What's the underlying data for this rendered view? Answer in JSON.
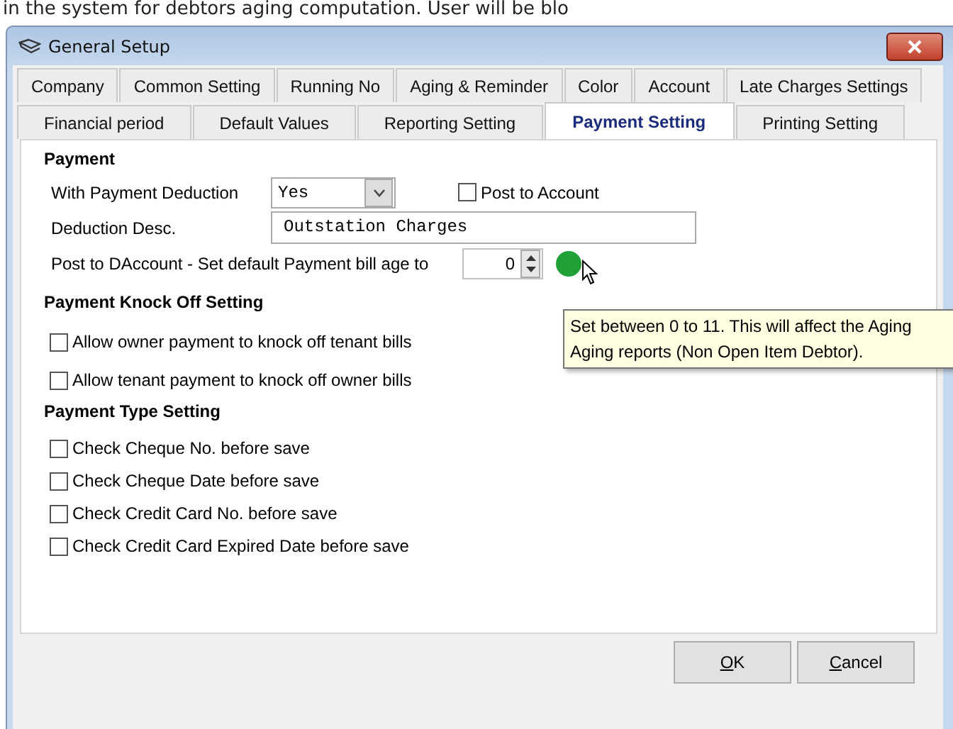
{
  "caption": "in the system for debtors aging computation. User will be blo",
  "window": {
    "title": "General Setup"
  },
  "tab_rows": [
    [
      {
        "label": "Company",
        "selected": false
      },
      {
        "label": "Common Setting",
        "selected": false
      },
      {
        "label": "Running No",
        "selected": false
      },
      {
        "label": "Aging & Reminder",
        "selected": false
      },
      {
        "label": "Color",
        "selected": false
      },
      {
        "label": "Account",
        "selected": false
      },
      {
        "label": "Late Charges Settings",
        "selected": false
      }
    ],
    [
      {
        "label": "Financial period",
        "selected": false
      },
      {
        "label": "Default Values",
        "selected": false
      },
      {
        "label": "Reporting Setting",
        "selected": false
      },
      {
        "label": "Payment Setting",
        "selected": true
      },
      {
        "label": "Printing Setting",
        "selected": false
      }
    ]
  ],
  "payment": {
    "heading": "Payment",
    "deduction_label": "With Payment Deduction",
    "deduction_value": "Yes",
    "post_to_account": {
      "label": "Post to Account",
      "checked": false
    },
    "desc_label": "Deduction Desc.",
    "desc_value": "Outstation Charges",
    "age_label": "Post to DAccount - Set default Payment bill age to",
    "age_value": "0"
  },
  "tooltip": [
    "Set between 0 to 11. This will affect the Aging",
    "Aging reports (Non Open Item Debtor)."
  ],
  "sections": [
    {
      "heading": "Payment Knock Off Setting",
      "options": [
        {
          "label": "Allow owner payment to knock off tenant bills",
          "checked": false
        },
        {
          "label": "Allow tenant payment to knock off owner bills",
          "checked": false
        }
      ]
    },
    {
      "heading": "Payment Type Setting",
      "options": [
        {
          "label": "Check Cheque No. before save",
          "checked": false
        },
        {
          "label": "Check Cheque Date before save",
          "checked": false
        },
        {
          "label": "Check Credit Card No. before save",
          "checked": false
        },
        {
          "label": "Check Credit Card Expired Date before save",
          "checked": false
        }
      ]
    }
  ],
  "buttons": [
    "OK",
    "Cancel"
  ]
}
